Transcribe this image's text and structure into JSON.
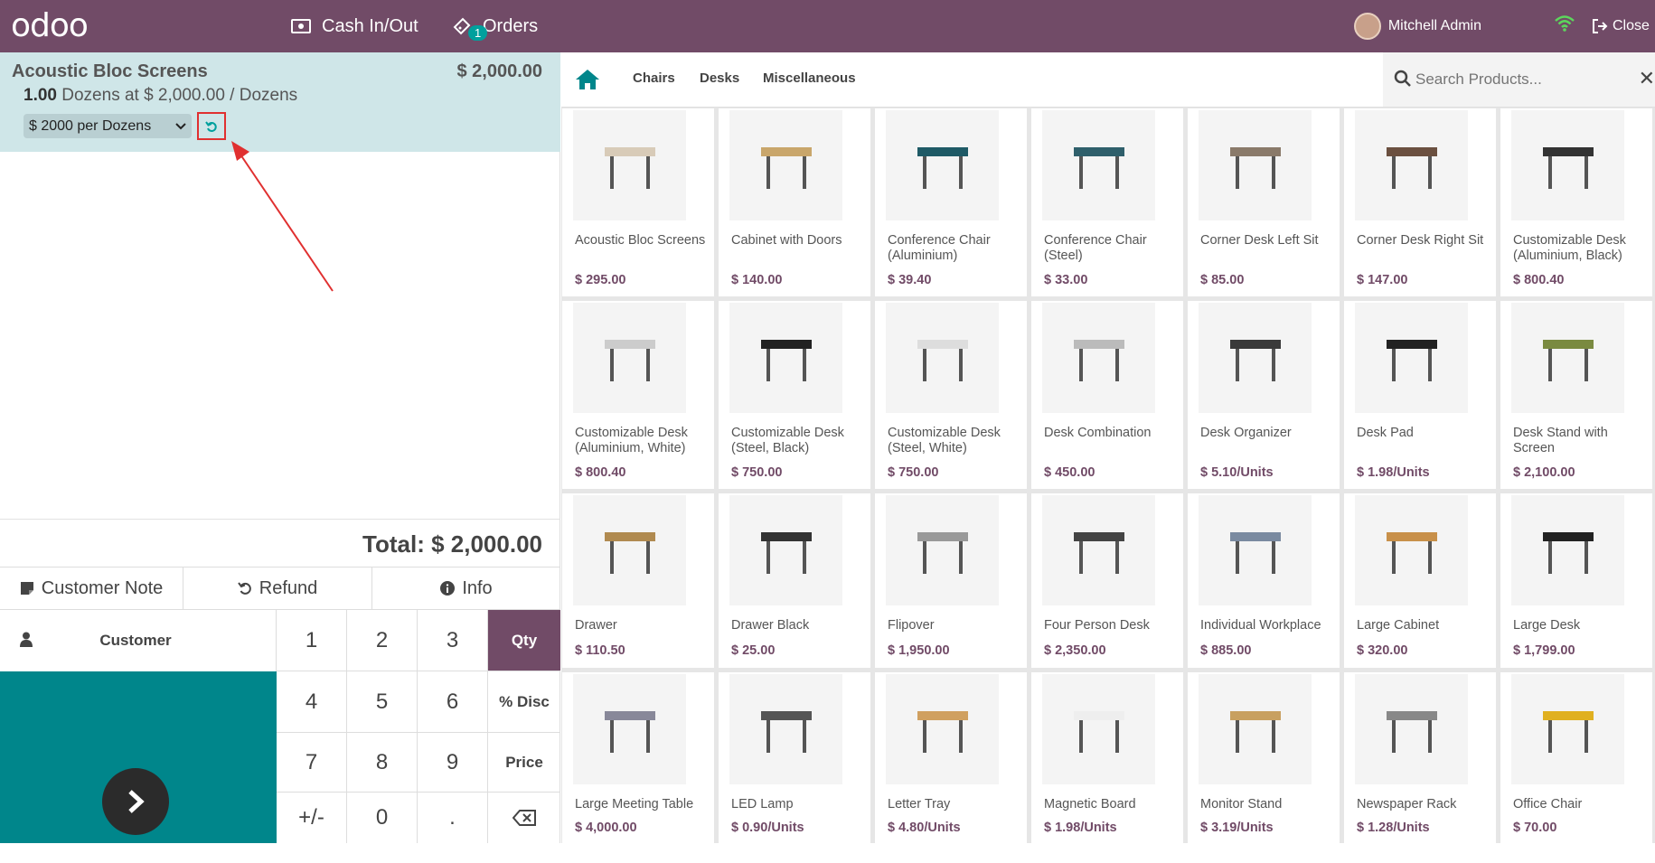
{
  "topbar": {
    "logo": "odoo",
    "cash_label": "Cash In/Out",
    "orders_label": "Orders",
    "orders_badge": "1",
    "user_name": "Mitchell Admin",
    "close_label": "Close",
    "brand_color": "#714b67",
    "accent_color": "#00a09d"
  },
  "order": {
    "line": {
      "name": "Acoustic Bloc Screens",
      "price": "$ 2,000.00",
      "qty": "1.00",
      "qty_text": "Dozens at $ 2,000.00 / Dozens",
      "pricelist_selected": "$ 2000 per Dozens"
    },
    "total": "Total: $ 2,000.00"
  },
  "controls": {
    "customer_note": "Customer Note",
    "refund": "Refund",
    "info": "Info",
    "customer": "Customer",
    "payment": "Payment"
  },
  "numpad": {
    "keys": [
      "1",
      "2",
      "3",
      "4",
      "5",
      "6",
      "7",
      "8",
      "9",
      "+/-",
      "0",
      "."
    ],
    "qty": "Qty",
    "disc": "% Disc",
    "price": "Price"
  },
  "categories": [
    "Chairs",
    "Desks",
    "Miscellaneous"
  ],
  "search": {
    "placeholder": "Search Products..."
  },
  "products": [
    {
      "name": "Acoustic Bloc Screens",
      "price": "$ 295.00",
      "icon": "screen-panel-icon"
    },
    {
      "name": "Cabinet with Doors",
      "price": "$ 140.00",
      "icon": "cabinet-icon"
    },
    {
      "name": "Conference Chair (Aluminium)",
      "price": "$ 39.40",
      "icon": "chair-icon"
    },
    {
      "name": "Conference Chair (Steel)",
      "price": "$ 33.00",
      "icon": "chair-icon"
    },
    {
      "name": "Corner Desk Left Sit",
      "price": "$ 85.00",
      "icon": "desk-icon"
    },
    {
      "name": "Corner Desk Right Sit",
      "price": "$ 147.00",
      "icon": "desk-icon"
    },
    {
      "name": "Customizable Desk (Aluminium, Black)",
      "price": "$ 800.40",
      "icon": "desk-icon"
    },
    {
      "name": "Customizable Desk (Aluminium, White)",
      "price": "$ 800.40",
      "icon": "desk-icon"
    },
    {
      "name": "Customizable Desk (Steel, Black)",
      "price": "$ 750.00",
      "icon": "desk-icon"
    },
    {
      "name": "Customizable Desk (Steel, White)",
      "price": "$ 750.00",
      "icon": "desk-icon"
    },
    {
      "name": "Desk Combination",
      "price": "$ 450.00",
      "icon": "desk-icon"
    },
    {
      "name": "Desk Organizer",
      "price": "$ 5.10/Units",
      "icon": "organizer-icon"
    },
    {
      "name": "Desk Pad",
      "price": "$ 1.98/Units",
      "icon": "pad-icon"
    },
    {
      "name": "Desk Stand with Screen",
      "price": "$ 2,100.00",
      "icon": "desk-icon"
    },
    {
      "name": "Drawer",
      "price": "$ 110.50",
      "icon": "drawer-icon"
    },
    {
      "name": "Drawer Black",
      "price": "$ 25.00",
      "icon": "drawer-icon"
    },
    {
      "name": "Flipover",
      "price": "$ 1,950.00",
      "icon": "flipchart-icon"
    },
    {
      "name": "Four Person Desk",
      "price": "$ 2,350.00",
      "icon": "desk-icon"
    },
    {
      "name": "Individual Workplace",
      "price": "$ 885.00",
      "icon": "pod-icon"
    },
    {
      "name": "Large Cabinet",
      "price": "$ 320.00",
      "icon": "cabinet-icon"
    },
    {
      "name": "Large Desk",
      "price": "$ 1,799.00",
      "icon": "desk-icon"
    },
    {
      "name": "Large Meeting Table",
      "price": "$ 4,000.00",
      "icon": "table-icon"
    },
    {
      "name": "LED Lamp",
      "price": "$ 0.90/Units",
      "icon": "lamp-icon"
    },
    {
      "name": "Letter Tray",
      "price": "$ 4.80/Units",
      "icon": "tray-icon"
    },
    {
      "name": "Magnetic Board",
      "price": "$ 1.98/Units",
      "icon": "board-icon"
    },
    {
      "name": "Monitor Stand",
      "price": "$ 3.19/Units",
      "icon": "stand-icon"
    },
    {
      "name": "Newspaper Rack",
      "price": "$ 1.28/Units",
      "icon": "rack-icon"
    },
    {
      "name": "Office Chair",
      "price": "$ 70.00",
      "icon": "chair-icon"
    }
  ]
}
